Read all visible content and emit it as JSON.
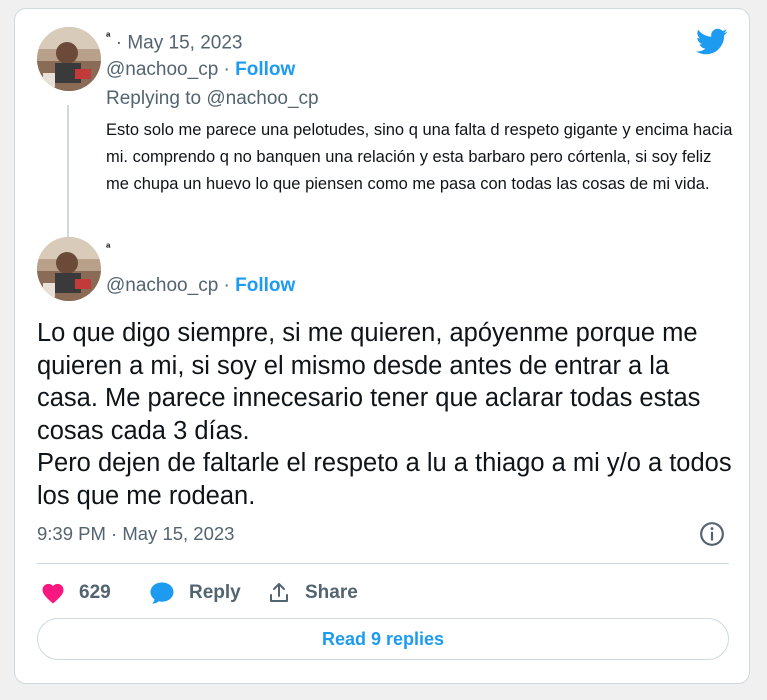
{
  "colors": {
    "accent": "#1d9bf0",
    "like": "#f91880",
    "muted": "#536471",
    "text": "#0f1419",
    "border": "#cfd9de"
  },
  "parent_tweet": {
    "display_name": "ª",
    "separator": "·",
    "date": "May 15, 2023",
    "handle": "@nachoo_cp",
    "follow_label": "Follow",
    "replying_label": "Replying to",
    "replying_to": "@nachoo_cp",
    "text": "Esto solo me parece una pelotudes, sino q una falta d respeto gigante y encima hacia mi. comprendo q no banquen una relación y esta barbaro pero córtenla, si soy feliz me chupa un huevo lo que piensen como me pasa con todas las cosas de mi vida."
  },
  "main_tweet": {
    "display_name": "ª",
    "handle": "@nachoo_cp",
    "follow_label": "Follow",
    "text": "Lo que digo siempre, si me quieren, apóyenme porque me quieren a mi, si soy el mismo desde antes de entrar a la casa. Me parece innecesario tener que aclarar todas estas cosas cada 3 días.\nPero dejen de faltarle el respeto a lu a thiago a mi y/o a todos los que me rodean.",
    "time": "9:39 PM",
    "date": "May 15, 2023"
  },
  "actions": {
    "like_count": "629",
    "reply_label": "Reply",
    "share_label": "Share"
  },
  "read_replies_label": "Read 9 replies",
  "icons": {
    "logo": "twitter-bird-icon",
    "info": "info-icon",
    "like": "heart-icon",
    "reply": "speech-bubble-icon",
    "share": "share-upload-icon"
  }
}
